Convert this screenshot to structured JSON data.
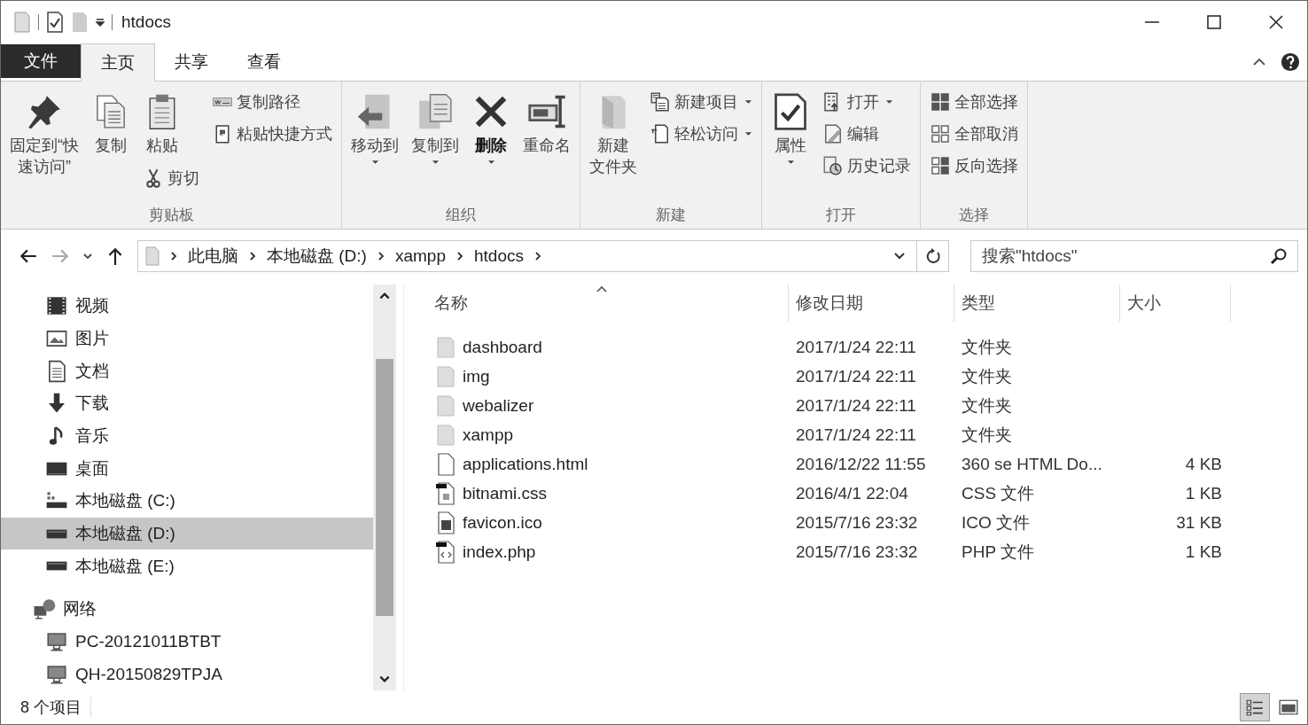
{
  "window": {
    "title": "htdocs"
  },
  "tabs": [
    {
      "label": "文件",
      "kind": "file",
      "selected": false
    },
    {
      "label": "主页",
      "kind": "tab",
      "selected": true
    },
    {
      "label": "共享",
      "kind": "tab",
      "selected": false
    },
    {
      "label": "查看",
      "kind": "tab",
      "selected": false
    }
  ],
  "ribbon": {
    "groups": [
      {
        "label": "剪贴板",
        "columns": [
          [
            {
              "lines": [
                "固定到“快",
                "速访问”"
              ],
              "kind": "large",
              "dropdown": false
            }
          ],
          [
            {
              "lines": [
                "复制"
              ],
              "kind": "large",
              "dropdown": false
            }
          ],
          [
            {
              "lines": [
                "粘贴"
              ],
              "kind": "large",
              "dropdown": false
            },
            {
              "label": "剪切",
              "kind": "small",
              "dropdown": false
            }
          ],
          [
            {
              "label": "复制路径",
              "kind": "small",
              "dropdown": false
            },
            {
              "label": "粘贴快捷方式",
              "kind": "small",
              "dropdown": false
            }
          ]
        ]
      },
      {
        "label": "组织",
        "columns": [
          [
            {
              "lines": [
                "移动到"
              ],
              "kind": "large",
              "dropdown": true
            }
          ],
          [
            {
              "lines": [
                "复制到"
              ],
              "kind": "large",
              "dropdown": true
            }
          ],
          [
            {
              "lines": [
                "删除"
              ],
              "kind": "large",
              "dropdown": true
            }
          ],
          [
            {
              "lines": [
                "重命名"
              ],
              "kind": "large",
              "dropdown": false
            }
          ]
        ]
      },
      {
        "label": "新建",
        "columns": [
          [
            {
              "lines": [
                "新建",
                "文件夹"
              ],
              "kind": "large",
              "dropdown": false
            }
          ],
          [
            {
              "label": "新建项目",
              "kind": "small",
              "dropdown": true
            },
            {
              "label": "轻松访问",
              "kind": "small",
              "dropdown": true
            }
          ]
        ]
      },
      {
        "label": "打开",
        "columns": [
          [
            {
              "lines": [
                "属性"
              ],
              "kind": "large",
              "dropdown": true
            }
          ],
          [
            {
              "label": "打开",
              "kind": "small",
              "dropdown": true
            },
            {
              "label": "编辑",
              "kind": "small",
              "dropdown": false
            },
            {
              "label": "历史记录",
              "kind": "small",
              "dropdown": false
            }
          ]
        ]
      },
      {
        "label": "选择",
        "columns": [
          [
            {
              "label": "全部选择",
              "kind": "small",
              "dropdown": false
            },
            {
              "label": "全部取消",
              "kind": "small",
              "dropdown": false
            },
            {
              "label": "反向选择",
              "kind": "small",
              "dropdown": false
            }
          ]
        ]
      }
    ]
  },
  "address": {
    "crumbs": [
      "此电脑",
      "本地磁盘 (D:)",
      "xampp",
      "htdocs"
    ]
  },
  "search": {
    "placeholder": "搜索\"htdocs\""
  },
  "sidebar": {
    "items": [
      {
        "label": "视频",
        "selected": false
      },
      {
        "label": "图片",
        "selected": false
      },
      {
        "label": "文档",
        "selected": false
      },
      {
        "label": "下载",
        "selected": false
      },
      {
        "label": "音乐",
        "selected": false
      },
      {
        "label": "桌面",
        "selected": false
      },
      {
        "label": "本地磁盘 (C:)",
        "selected": false
      },
      {
        "label": "本地磁盘 (D:)",
        "selected": true
      },
      {
        "label": "本地磁盘 (E:)",
        "selected": false
      }
    ],
    "network": {
      "label": "网络",
      "selected": false,
      "children": [
        {
          "label": "PC-20121011BTBT",
          "selected": false
        },
        {
          "label": "QH-20150829TPJA",
          "selected": false
        }
      ]
    }
  },
  "table": {
    "columns": [
      {
        "label": "名称",
        "sorted": true
      },
      {
        "label": "修改日期",
        "sorted": false
      },
      {
        "label": "类型",
        "sorted": false
      },
      {
        "label": "大小",
        "sorted": false
      }
    ],
    "rows": [
      {
        "kind": "folder",
        "name": "dashboard",
        "date": "2017/1/24 22:11",
        "type": "文件夹",
        "size": ""
      },
      {
        "kind": "folder",
        "name": "img",
        "date": "2017/1/24 22:11",
        "type": "文件夹",
        "size": ""
      },
      {
        "kind": "folder",
        "name": "webalizer",
        "date": "2017/1/24 22:11",
        "type": "文件夹",
        "size": ""
      },
      {
        "kind": "folder",
        "name": "xampp",
        "date": "2017/1/24 22:11",
        "type": "文件夹",
        "size": ""
      },
      {
        "kind": "html",
        "name": "applications.html",
        "date": "2016/12/22 11:55",
        "type": "360 se HTML Do...",
        "size": "4 KB"
      },
      {
        "kind": "css",
        "name": "bitnami.css",
        "date": "2016/4/1 22:04",
        "type": "CSS 文件",
        "size": "1 KB"
      },
      {
        "kind": "ico",
        "name": "favicon.ico",
        "date": "2015/7/16 23:32",
        "type": "ICO 文件",
        "size": "31 KB"
      },
      {
        "kind": "php",
        "name": "index.php",
        "date": "2015/7/16 23:32",
        "type": "PHP 文件",
        "size": "1 KB"
      }
    ]
  },
  "status_bar": {
    "text": "8 个项目",
    "views": [
      {
        "kind": "details",
        "selected": true
      },
      {
        "kind": "thumbnails",
        "selected": false
      }
    ]
  }
}
